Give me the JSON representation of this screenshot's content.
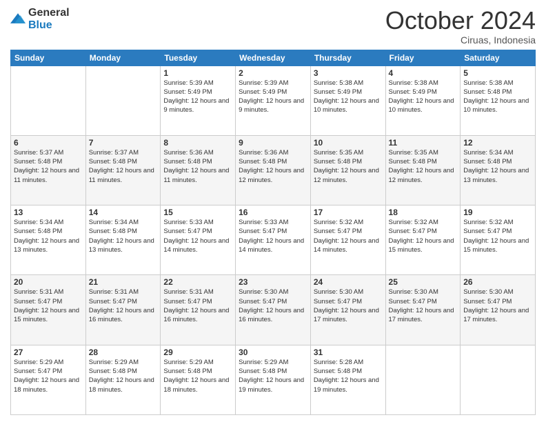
{
  "header": {
    "logo": {
      "general": "General",
      "blue": "Blue"
    },
    "title": "October 2024",
    "location": "Ciruas, Indonesia"
  },
  "calendar": {
    "days_of_week": [
      "Sunday",
      "Monday",
      "Tuesday",
      "Wednesday",
      "Thursday",
      "Friday",
      "Saturday"
    ],
    "weeks": [
      [
        {
          "day": "",
          "sunrise": "",
          "sunset": "",
          "daylight": ""
        },
        {
          "day": "",
          "sunrise": "",
          "sunset": "",
          "daylight": ""
        },
        {
          "day": "1",
          "sunrise": "Sunrise: 5:39 AM",
          "sunset": "Sunset: 5:49 PM",
          "daylight": "Daylight: 12 hours and 9 minutes."
        },
        {
          "day": "2",
          "sunrise": "Sunrise: 5:39 AM",
          "sunset": "Sunset: 5:49 PM",
          "daylight": "Daylight: 12 hours and 9 minutes."
        },
        {
          "day": "3",
          "sunrise": "Sunrise: 5:38 AM",
          "sunset": "Sunset: 5:49 PM",
          "daylight": "Daylight: 12 hours and 10 minutes."
        },
        {
          "day": "4",
          "sunrise": "Sunrise: 5:38 AM",
          "sunset": "Sunset: 5:49 PM",
          "daylight": "Daylight: 12 hours and 10 minutes."
        },
        {
          "day": "5",
          "sunrise": "Sunrise: 5:38 AM",
          "sunset": "Sunset: 5:48 PM",
          "daylight": "Daylight: 12 hours and 10 minutes."
        }
      ],
      [
        {
          "day": "6",
          "sunrise": "Sunrise: 5:37 AM",
          "sunset": "Sunset: 5:48 PM",
          "daylight": "Daylight: 12 hours and 11 minutes."
        },
        {
          "day": "7",
          "sunrise": "Sunrise: 5:37 AM",
          "sunset": "Sunset: 5:48 PM",
          "daylight": "Daylight: 12 hours and 11 minutes."
        },
        {
          "day": "8",
          "sunrise": "Sunrise: 5:36 AM",
          "sunset": "Sunset: 5:48 PM",
          "daylight": "Daylight: 12 hours and 11 minutes."
        },
        {
          "day": "9",
          "sunrise": "Sunrise: 5:36 AM",
          "sunset": "Sunset: 5:48 PM",
          "daylight": "Daylight: 12 hours and 12 minutes."
        },
        {
          "day": "10",
          "sunrise": "Sunrise: 5:35 AM",
          "sunset": "Sunset: 5:48 PM",
          "daylight": "Daylight: 12 hours and 12 minutes."
        },
        {
          "day": "11",
          "sunrise": "Sunrise: 5:35 AM",
          "sunset": "Sunset: 5:48 PM",
          "daylight": "Daylight: 12 hours and 12 minutes."
        },
        {
          "day": "12",
          "sunrise": "Sunrise: 5:34 AM",
          "sunset": "Sunset: 5:48 PM",
          "daylight": "Daylight: 12 hours and 13 minutes."
        }
      ],
      [
        {
          "day": "13",
          "sunrise": "Sunrise: 5:34 AM",
          "sunset": "Sunset: 5:48 PM",
          "daylight": "Daylight: 12 hours and 13 minutes."
        },
        {
          "day": "14",
          "sunrise": "Sunrise: 5:34 AM",
          "sunset": "Sunset: 5:48 PM",
          "daylight": "Daylight: 12 hours and 13 minutes."
        },
        {
          "day": "15",
          "sunrise": "Sunrise: 5:33 AM",
          "sunset": "Sunset: 5:47 PM",
          "daylight": "Daylight: 12 hours and 14 minutes."
        },
        {
          "day": "16",
          "sunrise": "Sunrise: 5:33 AM",
          "sunset": "Sunset: 5:47 PM",
          "daylight": "Daylight: 12 hours and 14 minutes."
        },
        {
          "day": "17",
          "sunrise": "Sunrise: 5:32 AM",
          "sunset": "Sunset: 5:47 PM",
          "daylight": "Daylight: 12 hours and 14 minutes."
        },
        {
          "day": "18",
          "sunrise": "Sunrise: 5:32 AM",
          "sunset": "Sunset: 5:47 PM",
          "daylight": "Daylight: 12 hours and 15 minutes."
        },
        {
          "day": "19",
          "sunrise": "Sunrise: 5:32 AM",
          "sunset": "Sunset: 5:47 PM",
          "daylight": "Daylight: 12 hours and 15 minutes."
        }
      ],
      [
        {
          "day": "20",
          "sunrise": "Sunrise: 5:31 AM",
          "sunset": "Sunset: 5:47 PM",
          "daylight": "Daylight: 12 hours and 15 minutes."
        },
        {
          "day": "21",
          "sunrise": "Sunrise: 5:31 AM",
          "sunset": "Sunset: 5:47 PM",
          "daylight": "Daylight: 12 hours and 16 minutes."
        },
        {
          "day": "22",
          "sunrise": "Sunrise: 5:31 AM",
          "sunset": "Sunset: 5:47 PM",
          "daylight": "Daylight: 12 hours and 16 minutes."
        },
        {
          "day": "23",
          "sunrise": "Sunrise: 5:30 AM",
          "sunset": "Sunset: 5:47 PM",
          "daylight": "Daylight: 12 hours and 16 minutes."
        },
        {
          "day": "24",
          "sunrise": "Sunrise: 5:30 AM",
          "sunset": "Sunset: 5:47 PM",
          "daylight": "Daylight: 12 hours and 17 minutes."
        },
        {
          "day": "25",
          "sunrise": "Sunrise: 5:30 AM",
          "sunset": "Sunset: 5:47 PM",
          "daylight": "Daylight: 12 hours and 17 minutes."
        },
        {
          "day": "26",
          "sunrise": "Sunrise: 5:30 AM",
          "sunset": "Sunset: 5:47 PM",
          "daylight": "Daylight: 12 hours and 17 minutes."
        }
      ],
      [
        {
          "day": "27",
          "sunrise": "Sunrise: 5:29 AM",
          "sunset": "Sunset: 5:47 PM",
          "daylight": "Daylight: 12 hours and 18 minutes."
        },
        {
          "day": "28",
          "sunrise": "Sunrise: 5:29 AM",
          "sunset": "Sunset: 5:48 PM",
          "daylight": "Daylight: 12 hours and 18 minutes."
        },
        {
          "day": "29",
          "sunrise": "Sunrise: 5:29 AM",
          "sunset": "Sunset: 5:48 PM",
          "daylight": "Daylight: 12 hours and 18 minutes."
        },
        {
          "day": "30",
          "sunrise": "Sunrise: 5:29 AM",
          "sunset": "Sunset: 5:48 PM",
          "daylight": "Daylight: 12 hours and 19 minutes."
        },
        {
          "day": "31",
          "sunrise": "Sunrise: 5:28 AM",
          "sunset": "Sunset: 5:48 PM",
          "daylight": "Daylight: 12 hours and 19 minutes."
        },
        {
          "day": "",
          "sunrise": "",
          "sunset": "",
          "daylight": ""
        },
        {
          "day": "",
          "sunrise": "",
          "sunset": "",
          "daylight": ""
        }
      ]
    ]
  }
}
